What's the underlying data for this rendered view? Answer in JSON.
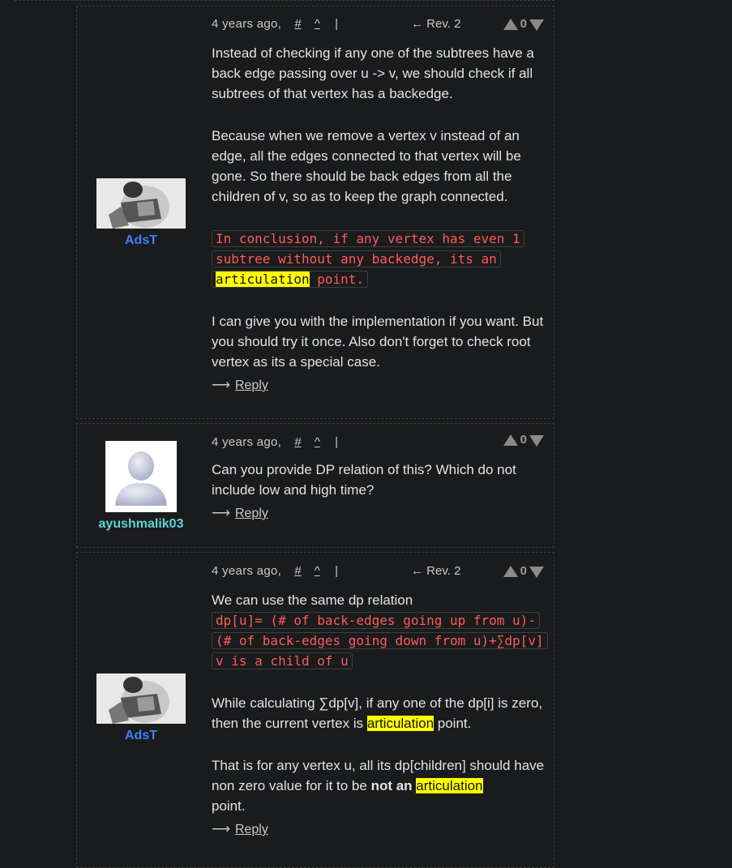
{
  "comments": [
    {
      "user": "AdsT",
      "time": "4 years ago,",
      "hash": "#",
      "caret": "^",
      "pipe": "|",
      "rev": "← Rev. 2",
      "votes": "0",
      "p1": "Instead of checking if any one of the subtrees have a back edge passing over u -> v, we should check if all subtrees of that vertex has a backedge.",
      "p2": "Because when we remove a vertex v instead of an edge, all the edges connected to that vertex will be gone. So there should be back edges from all the children of v, so as to keep the graph connected.",
      "code_pre": "In conclusion, if any vertex has even 1 subtree without any backedge, its an",
      "code_hl": "articulation",
      "code_post": " point.",
      "p3": "I can give you with the implementation if you want. But you should try it once. Also don't forget to check root vertex as its a special case.",
      "reply_arrow": "⟶",
      "reply": "Reply"
    },
    {
      "user": "ayushmalik03",
      "time": "4 years ago,",
      "hash": "#",
      "caret": "^",
      "pipe": "|",
      "votes": "0",
      "p1": "Can you provide DP relation of this? Which do not include low and high time?",
      "reply_arrow": "⟶",
      "reply": "Reply"
    },
    {
      "user": "AdsT",
      "time": "4 years ago,",
      "hash": "#",
      "caret": "^",
      "pipe": "|",
      "rev": "← Rev. 2",
      "votes": "0",
      "p1": "We can use the same dp relation",
      "code": "dp[u]= (# of back-edges going up from u)-(# of back-edges going down from u)+∑dp[v] v is a child of u",
      "p2_pre": "While calculating ∑dp[v], if any one of the dp[i] is zero, then the current vertex is ",
      "p2_hl": "articulation",
      "p2_post": " point.",
      "p3_pre": "That is for any vertex u, all its dp[children] should have non zero value for it to be ",
      "p3_bold": "not an",
      "p3_hl": "articulation",
      "p3_post": "point.",
      "reply_arrow": "⟶",
      "reply": "Reply"
    }
  ]
}
